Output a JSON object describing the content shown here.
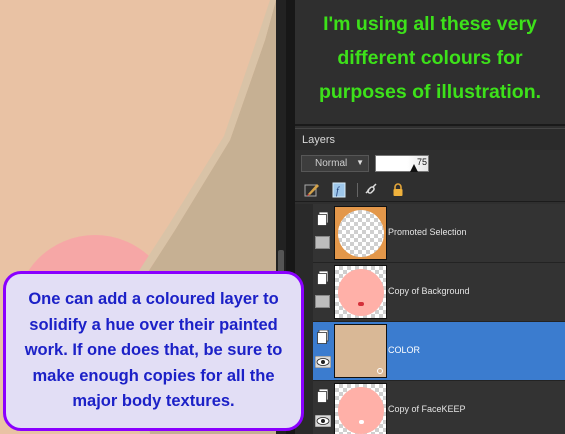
{
  "note": {
    "text": "I'm using all these very different colours for purposes of illustration.",
    "color": "#3de11a"
  },
  "layers_panel": {
    "title": "Layers",
    "blend_mode": "Normal",
    "opacity": "75",
    "opacity_fraction": 0.75,
    "tools": [
      "brush-icon",
      "fx-icon",
      "link-icon",
      "lock-icon"
    ],
    "layers": [
      {
        "name": "Promoted Selection",
        "selected": false,
        "visible": false
      },
      {
        "name": "Copy of Background",
        "selected": false,
        "visible": false
      },
      {
        "name": "COLOR",
        "selected": true,
        "visible": true
      },
      {
        "name": "Copy of FaceKEEP",
        "selected": false,
        "visible": true
      }
    ]
  },
  "callout": {
    "text": "One can add a coloured layer to solidify a hue over their painted work. If one does that, be sure to make enough copies for all the major body textures.",
    "border_color": "#8a00ff",
    "text_color": "#1c21c7"
  },
  "colors": {
    "canvas_skin": "#e8c1a3",
    "selection_blue": "#3b7ccf",
    "thumb_orange": "#e3974a",
    "thumb_pink": "#ffb0a8",
    "thumb_tan": "#d9b896"
  }
}
